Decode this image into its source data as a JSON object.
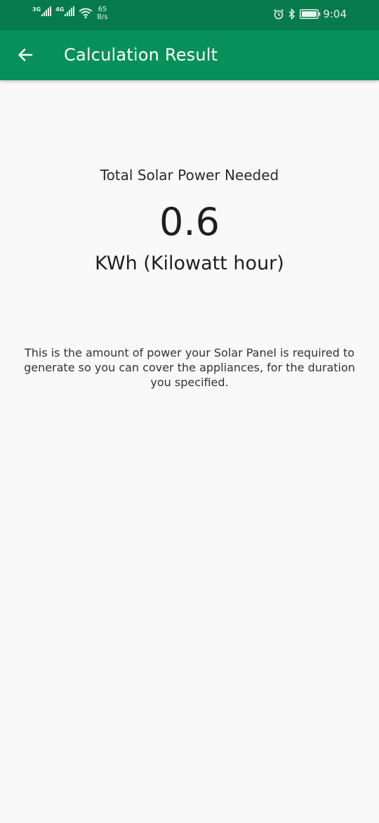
{
  "status_bar": {
    "signal1_label": "3G",
    "signal2_label": "4G",
    "net_speed_value": "65",
    "net_speed_unit": "B/s",
    "time": "9:04",
    "icons": [
      "signal-icon",
      "wifi-icon",
      "alarm-icon",
      "bluetooth-icon",
      "battery-icon"
    ]
  },
  "app_bar": {
    "title": "Calculation Result",
    "back_icon": "arrow-left-icon"
  },
  "result": {
    "label": "Total Solar Power Needed",
    "value": "0.6",
    "unit": "KWh (Kilowatt hour)",
    "description": "This is the amount of power your Solar Panel is required to generate so you can cover the appliances, for the duration you specified."
  },
  "colors": {
    "status_bar": "#067a4b",
    "app_bar": "#079059",
    "background": "#f9f9f9",
    "text": "#222222"
  }
}
